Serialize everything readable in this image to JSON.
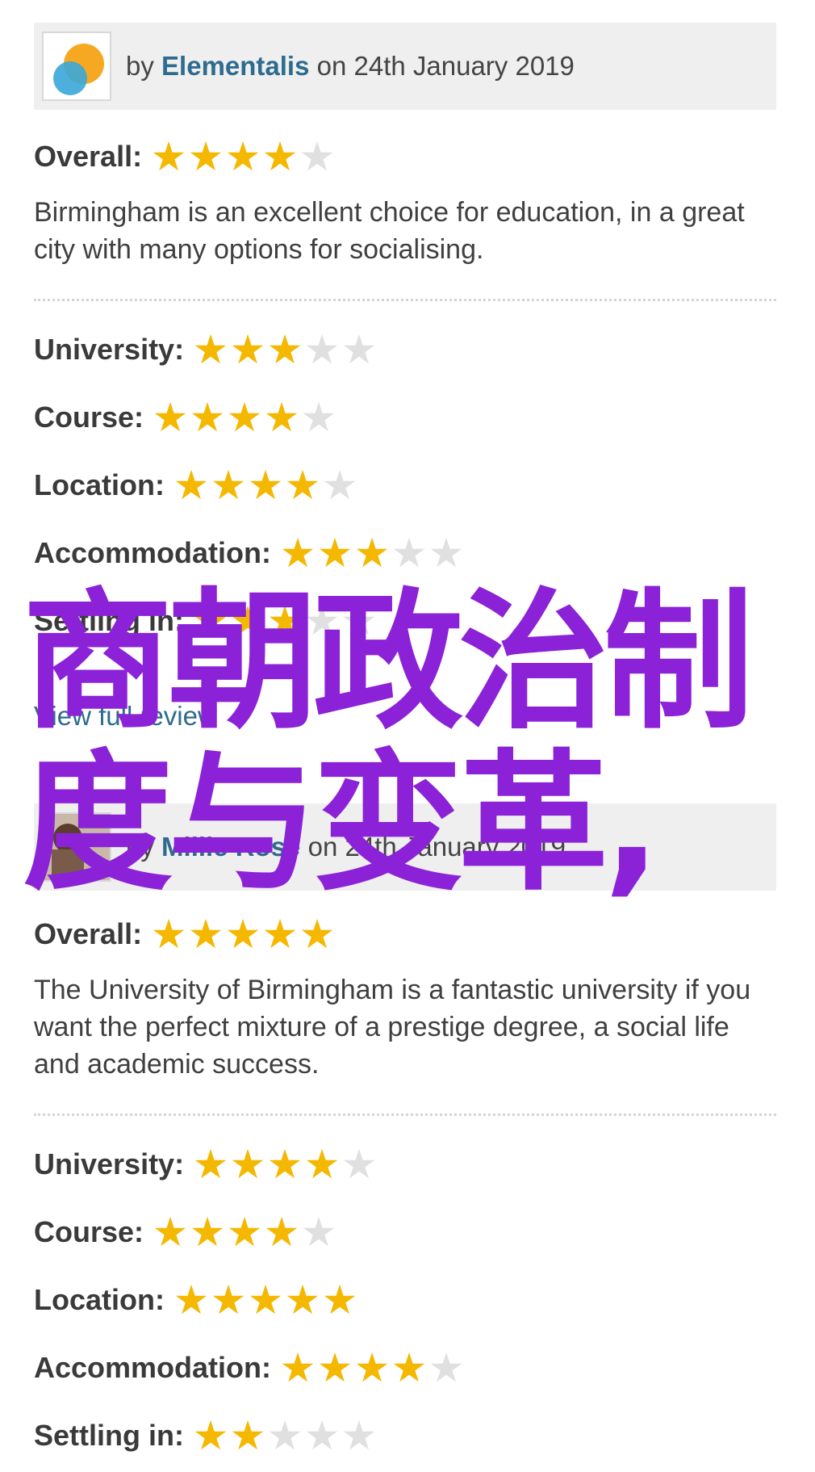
{
  "colors": {
    "star_on": "#f5b800",
    "star_off": "#e0e0e0",
    "author_link": "#2e6b8e",
    "overlay_text": "#8b22d8"
  },
  "review1": {
    "by": "by",
    "author": "Elementalis",
    "date": "on 24th January 2019",
    "overall": {
      "label": "Overall:",
      "stars": 4
    },
    "text": "Birmingham is an excellent choice for education, in a great city with many options for socialising.",
    "ratings": [
      {
        "label": "University:",
        "stars": 3
      },
      {
        "label": "Course:",
        "stars": 4
      },
      {
        "label": "Location:",
        "stars": 4
      },
      {
        "label": "Accommodation:",
        "stars": 3
      },
      {
        "label": "Settling in:",
        "stars": 3
      }
    ],
    "view_full": "View full review"
  },
  "review2": {
    "by": "by",
    "author": "Millie Rose",
    "date": "on 24th January 2019",
    "overall": {
      "label": "Overall:",
      "stars": 5
    },
    "text": "The University of Birmingham is a fantastic university if you want the perfect mixture of a prestige degree, a social life and academic success.",
    "ratings": [
      {
        "label": "University:",
        "stars": 4
      },
      {
        "label": "Course:",
        "stars": 4
      },
      {
        "label": "Location:",
        "stars": 5
      },
      {
        "label": "Accommodation:",
        "stars": 4
      },
      {
        "label": "Settling in:",
        "stars": 2
      }
    ]
  },
  "overlay": {
    "line1": "商朝政治制",
    "line2": "度与变革,"
  }
}
